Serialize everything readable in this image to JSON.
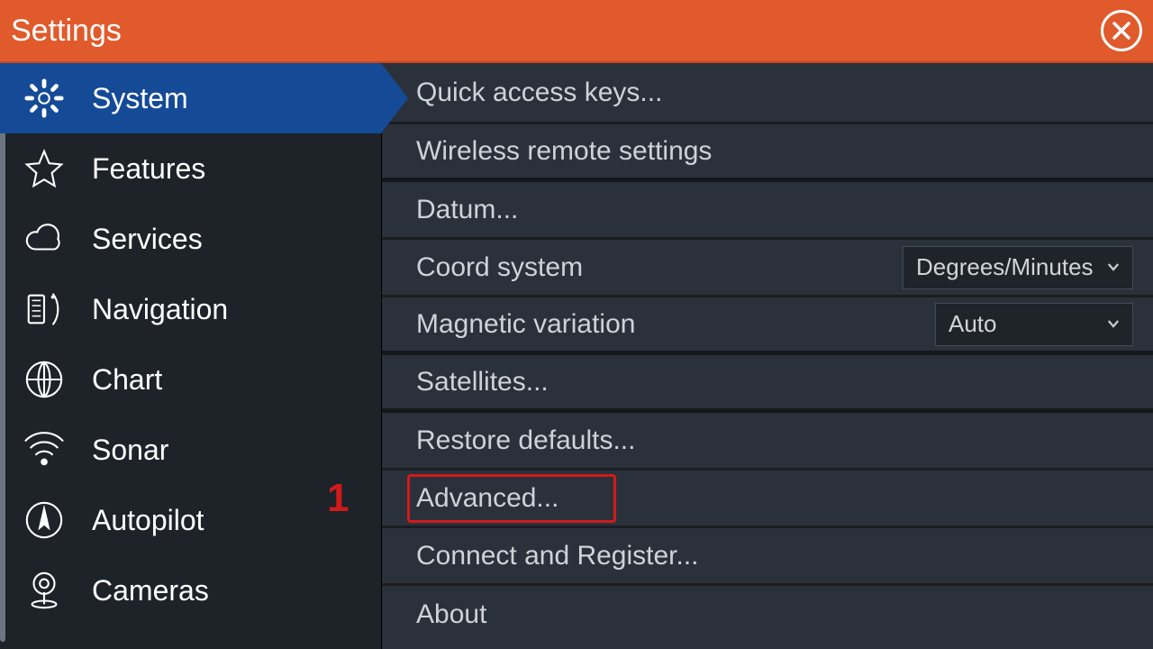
{
  "titlebar": {
    "title": "Settings"
  },
  "sidebar": {
    "items": [
      {
        "label": "System"
      },
      {
        "label": "Features"
      },
      {
        "label": "Services"
      },
      {
        "label": "Navigation"
      },
      {
        "label": "Chart"
      },
      {
        "label": "Sonar"
      },
      {
        "label": "Autopilot"
      },
      {
        "label": "Cameras"
      }
    ]
  },
  "panel": {
    "rows": {
      "quick_access": "Quick access keys...",
      "wireless": "Wireless remote settings",
      "datum": "Datum...",
      "coord_system_label": "Coord system",
      "coord_system_value": "Degrees/Minutes",
      "mag_var_label": "Magnetic variation",
      "mag_var_value": "Auto",
      "satellites": "Satellites...",
      "restore": "Restore defaults...",
      "advanced": "Advanced...",
      "connect_register": "Connect and Register...",
      "about": "About"
    }
  },
  "annotation": {
    "number": "1"
  }
}
